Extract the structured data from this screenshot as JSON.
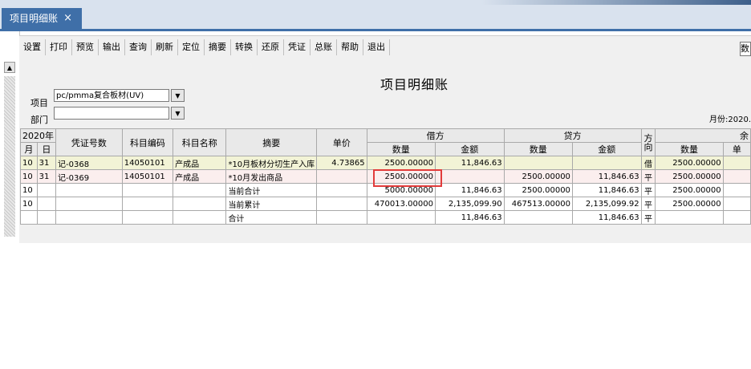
{
  "tab": {
    "label": "项目明细账",
    "close": "×"
  },
  "menu": [
    "设置",
    "打印",
    "预览",
    "输出",
    "查询",
    "刷新",
    "定位",
    "摘要",
    "转换",
    "还原",
    "凭证",
    "总账",
    "帮助",
    "退出"
  ],
  "corner_box": "数",
  "title": "项目明细账",
  "filters": {
    "project_label": "项目",
    "project_value": "pc/pmma复合板材(UV)",
    "dept_label": "部门",
    "dept_value": ""
  },
  "month_label": "月份:2020.",
  "headers": {
    "year": "2020年",
    "month": "月",
    "day": "日",
    "voucher": "凭证号数",
    "code": "科目编码",
    "name": "科目名称",
    "summary": "摘要",
    "unit_price": "单价",
    "debit": "借方",
    "credit": "贷方",
    "direction": "方向",
    "balance": "余",
    "qty": "数量",
    "amount": "金额",
    "unit": "单"
  },
  "rows": [
    {
      "m": "10",
      "d": "31",
      "voucher": "记-0368",
      "code": "14050101",
      "name": "产成品",
      "summary": "*10月板材分切生产入库",
      "price": "4.73865",
      "dqty": "2500.00000",
      "damt": "11,846.63",
      "cqty": "",
      "camt": "",
      "dir": "借",
      "bqty": "2500.00000",
      "bunit": ""
    },
    {
      "m": "10",
      "d": "31",
      "voucher": "记-0369",
      "code": "14050101",
      "name": "产成品",
      "summary": "*10月发出商品",
      "price": "",
      "dqty": "2500.00000",
      "damt": "",
      "cqty": "2500.00000",
      "camt": "11,846.63",
      "dir": "平",
      "bqty": "2500.00000",
      "bunit": ""
    },
    {
      "m": "10",
      "d": "",
      "voucher": "",
      "code": "",
      "name": "",
      "summary": "当前合计",
      "price": "",
      "dqty": "5000.00000",
      "damt": "11,846.63",
      "cqty": "2500.00000",
      "camt": "11,846.63",
      "dir": "平",
      "bqty": "2500.00000",
      "bunit": ""
    },
    {
      "m": "10",
      "d": "",
      "voucher": "",
      "code": "",
      "name": "",
      "summary": "当前累计",
      "price": "",
      "dqty": "470013.00000",
      "damt": "2,135,099.90",
      "cqty": "467513.00000",
      "camt": "2,135,099.92",
      "dir": "平",
      "bqty": "2500.00000",
      "bunit": ""
    },
    {
      "m": "",
      "d": "",
      "voucher": "",
      "code": "",
      "name": "",
      "summary": "合计",
      "price": "",
      "dqty": "",
      "damt": "11,846.63",
      "cqty": "",
      "camt": "11,846.63",
      "dir": "平",
      "bqty": "",
      "bunit": ""
    }
  ],
  "colors": {
    "tab": "#3f6fa8",
    "row_debit": "#f2f3d6",
    "row_credit": "#fbeeee",
    "highlight": "#e23b3b"
  }
}
